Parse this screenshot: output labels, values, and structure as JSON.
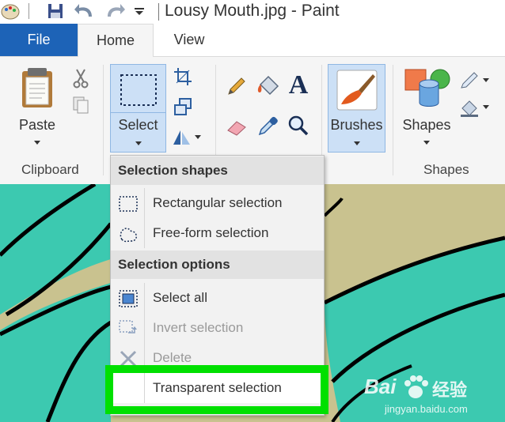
{
  "window": {
    "title": "Lousy Mouth.jpg - Paint"
  },
  "tabs": {
    "file": "File",
    "home": "Home",
    "view": "View"
  },
  "ribbon": {
    "paste": "Paste",
    "select": "Select",
    "brushes": "Brushes",
    "shapes": "Shapes",
    "groups": {
      "clipboard": "Clipboard",
      "shapes": "Shapes"
    }
  },
  "menu": {
    "section1": "Selection shapes",
    "rect": "Rectangular selection",
    "freeform": "Free-form selection",
    "section2": "Selection options",
    "select_all": "Select all",
    "invert": "Invert selection",
    "delete": "Delete",
    "transparent": "Transparent selection"
  },
  "watermark": {
    "brand": "Bai",
    "brand2": "经验",
    "url": "jingyan.baidu.com"
  },
  "colors": {
    "file_tab": "#1d63b7",
    "highlight": "#00e000",
    "canvas_teal": "#3cc9b0",
    "canvas_tan": "#c9c28f",
    "selected_button": "#cce0f6"
  }
}
